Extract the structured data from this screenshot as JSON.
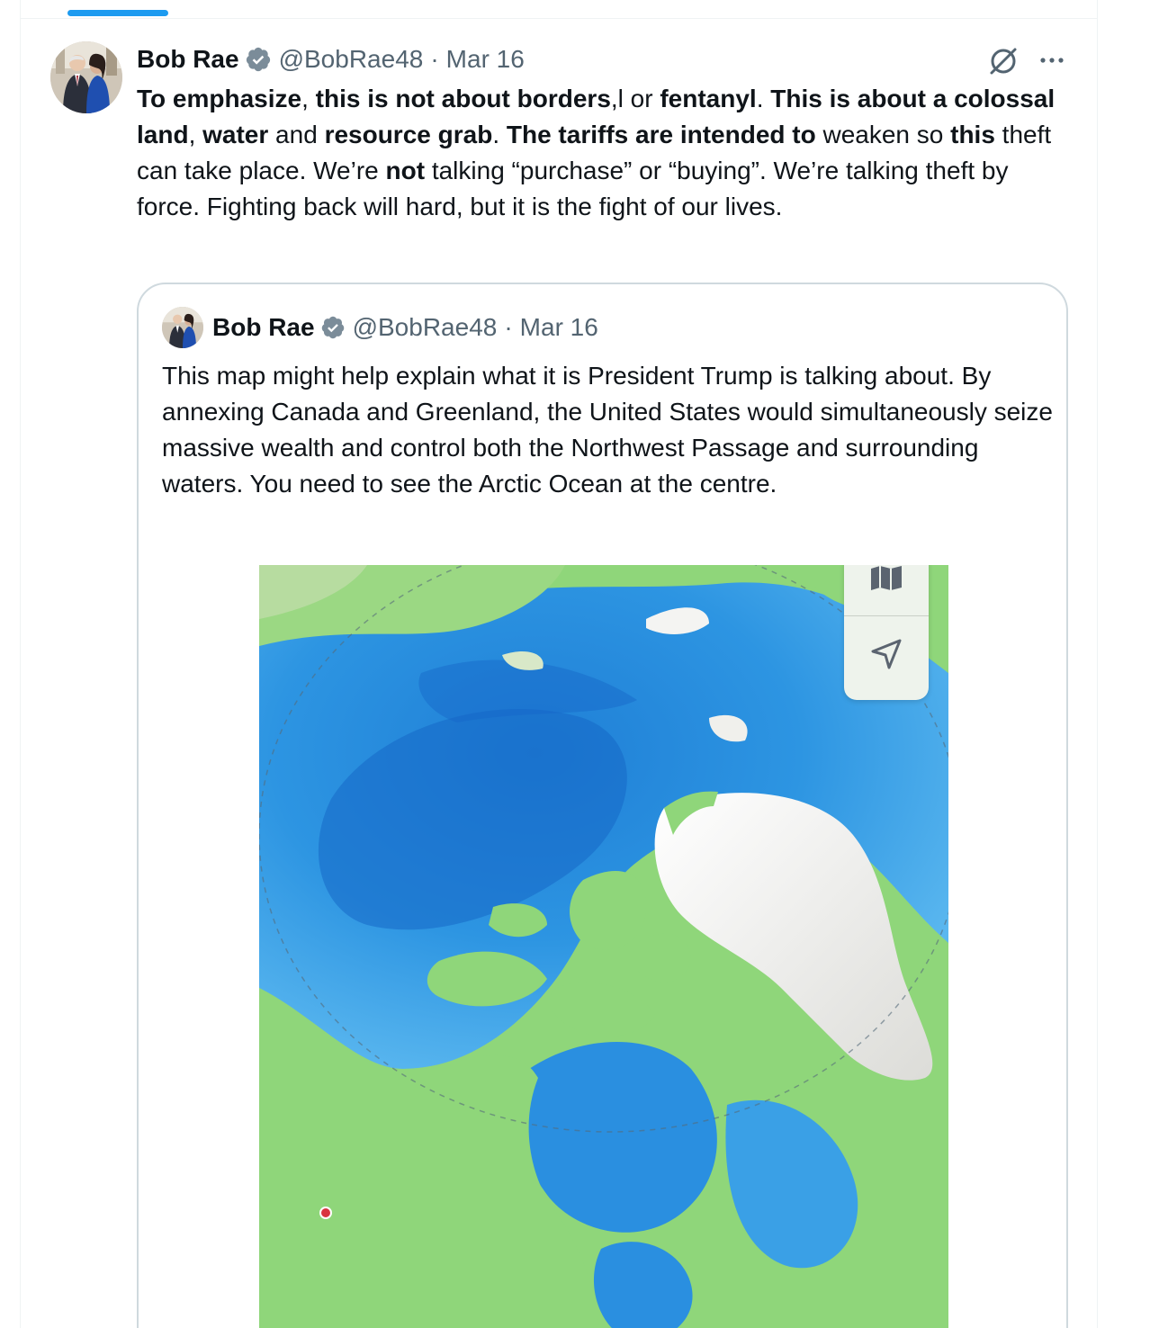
{
  "tweet": {
    "author_name": "Bob Rae",
    "handle": "@BobRae48",
    "separator": "·",
    "date": "Mar 16",
    "text_parts": [
      {
        "t": "To emphasize",
        "b": true
      },
      {
        "t": ", ",
        "b": false
      },
      {
        "t": "this is not about borders",
        "b": true
      },
      {
        "t": ",l or ",
        "b": false
      },
      {
        "t": "fentanyl",
        "b": true
      },
      {
        "t": ".  ",
        "b": false
      },
      {
        "t": "This is about a colossal land",
        "b": true
      },
      {
        "t": ", ",
        "b": false
      },
      {
        "t": "water",
        "b": true
      },
      {
        "t": " and ",
        "b": false
      },
      {
        "t": "resource grab",
        "b": true
      },
      {
        "t": ". ",
        "b": false
      },
      {
        "t": "The tariffs are intended to",
        "b": true
      },
      {
        "t": " weaken so ",
        "b": false
      },
      {
        "t": "this",
        "b": true
      },
      {
        "t": " theft can take place.  We’re ",
        "b": false
      },
      {
        "t": "not",
        "b": true
      },
      {
        "t": " talking “purchase” or “buying”.  We’re talking theft by force.  Fighting back will hard, but it is the fight of our lives.",
        "b": false
      }
    ]
  },
  "quoted_tweet": {
    "author_name": "Bob Rae",
    "handle": "@BobRae48",
    "separator": "·",
    "date": "Mar 16",
    "text": "This map might help explain what it is President Trump is talking about. By annexing Canada and Greenland, the United States would simultaneously seize massive wealth and control both the Northwest Passage and surrounding waters. You need to see the Arctic Ocean at the centre."
  },
  "icons": {
    "verified": "verified-badge-icon",
    "grok": "grok-icon",
    "more": "more-options-icon",
    "map_mode": "map-mode-icon",
    "location": "location-arrow-icon"
  },
  "colors": {
    "accent": "#1d9bf0",
    "secondary_text": "#536471",
    "border": "#cfd9de",
    "ocean": "#2f93e0",
    "land": "#8fd67a",
    "ice": "#f4f4f2"
  }
}
